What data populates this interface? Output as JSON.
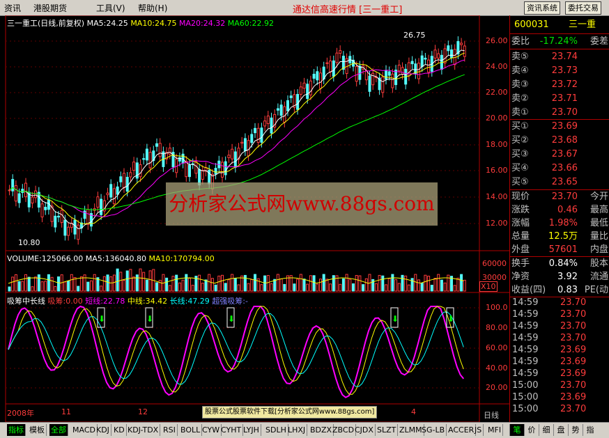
{
  "menu": {
    "items": [
      "资讯",
      "港股期货",
      "工具(V)",
      "帮助(H)"
    ],
    "title": "通达信高速行情 [三一重工]",
    "btn_info": "资讯系统",
    "btn_trade": "委托交易"
  },
  "price_chart": {
    "header": "三一重工(日线,前复权)",
    "ma5": "MA5:24.25",
    "ma10": "MA10:24.75",
    "ma20": "MA20:24.32",
    "ma60": "MA60:22.92",
    "high_mark": "26.75",
    "low_mark": "10.80",
    "axis": [
      "26.00",
      "24.00",
      "22.00",
      "20.00",
      "18.00",
      "16.00",
      "14.00",
      "12.00"
    ],
    "watermark": "分析家公式网www.88gs.com"
  },
  "volume_chart": {
    "header": "VOLUME:125066.00",
    "ma5": "MA5:136040.80",
    "ma10": "MA10:170794.00",
    "axis": [
      "60000",
      "30000"
    ],
    "unit": "X10"
  },
  "indicator_chart": {
    "name": "吸筹中长线",
    "xichou": "吸筹:0.00",
    "short": "短线:22.78",
    "mid": "中线:34.42",
    "long": "长线:47.29",
    "super": "超强吸筹:-",
    "axis": [
      "100.0",
      "80.00",
      "60.00",
      "40.00",
      "20.00"
    ],
    "x_labels": [
      "2008年",
      "11",
      "12",
      "4"
    ],
    "banner": "股票公式股票软件下载[分析家公式网www.88gs.com]",
    "period": "日线"
  },
  "quote": {
    "code": "600031",
    "name": "三一重",
    "weibi_label": "委比",
    "weibi": "-17.24%",
    "weicha_label": "委差",
    "sells": [
      {
        "label": "卖⑤",
        "price": "23.74"
      },
      {
        "label": "卖④",
        "price": "23.73"
      },
      {
        "label": "卖③",
        "price": "23.72"
      },
      {
        "label": "卖②",
        "price": "23.71"
      },
      {
        "label": "卖①",
        "price": "23.70"
      }
    ],
    "buys": [
      {
        "label": "买①",
        "price": "23.69"
      },
      {
        "label": "买②",
        "price": "23.68"
      },
      {
        "label": "买③",
        "price": "23.67"
      },
      {
        "label": "买④",
        "price": "23.66"
      },
      {
        "label": "买⑤",
        "price": "23.65"
      }
    ],
    "stats": [
      {
        "label": "现价",
        "value": "23.70",
        "label2": "今开"
      },
      {
        "label": "涨跌",
        "value": "0.46",
        "label2": "最高"
      },
      {
        "label": "涨幅",
        "value": "1.98%",
        "label2": "最低"
      },
      {
        "label": "总量",
        "value": "12.5万",
        "label2": "量比"
      },
      {
        "label": "外盘",
        "value": "57601",
        "label2": "内盘"
      }
    ],
    "stats2": [
      {
        "label": "换手",
        "value": "0.84%",
        "label2": "股本"
      },
      {
        "label": "净资",
        "value": "3.92",
        "label2": "流通"
      },
      {
        "label": "收益(四)",
        "value": "0.83",
        "label2": "PE(动"
      }
    ],
    "ticks": [
      {
        "time": "14:59",
        "price": "23.70"
      },
      {
        "time": "14:59",
        "price": "23.70"
      },
      {
        "time": "14:59",
        "price": "23.70"
      },
      {
        "time": "14:59",
        "price": "23.70"
      },
      {
        "time": "14:59",
        "price": "23.69"
      },
      {
        "time": "14:59",
        "price": "23.69"
      },
      {
        "time": "14:59",
        "price": "23.69"
      },
      {
        "time": "15:00",
        "price": "23.70"
      },
      {
        "time": "15:00",
        "price": "23.69"
      },
      {
        "time": "15:00",
        "price": "23.70"
      }
    ]
  },
  "tabs": [
    "指标",
    "模板",
    "全部",
    "MACD",
    "KDJ",
    "KD",
    "KDJ-TDX",
    "RSI",
    "BOLL",
    "CYW",
    "CYHT",
    "LYJH",
    "SDLH",
    "LHXJ",
    "BDZX",
    "ZBCD",
    "CJDX",
    "SLZT",
    "ZLMM",
    "SG-LB",
    "ACCER",
    "JS",
    "MFI"
  ],
  "right_tabs": [
    "笔",
    "价",
    "细",
    "盘",
    "势",
    "指"
  ]
}
